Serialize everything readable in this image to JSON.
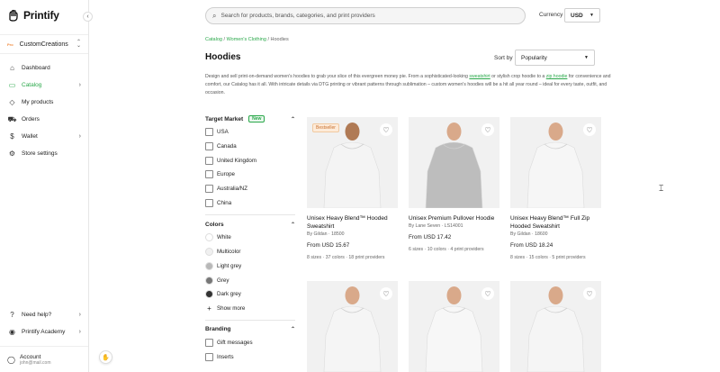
{
  "brand": {
    "name": "Printify"
  },
  "store": {
    "badge": "Pro",
    "name": "CustomCreations"
  },
  "nav": [
    {
      "label": "Dashboard",
      "icon": "home-icon",
      "glyph": "⌂",
      "active": false,
      "chev": ""
    },
    {
      "label": "Catalog",
      "icon": "catalog-icon",
      "glyph": "▭",
      "active": true,
      "chev": "›"
    },
    {
      "label": "My products",
      "icon": "tag-icon",
      "glyph": "◇",
      "active": false,
      "chev": ""
    },
    {
      "label": "Orders",
      "icon": "truck-icon",
      "glyph": "⛟",
      "active": false,
      "chev": ""
    },
    {
      "label": "Wallet",
      "icon": "dollar-icon",
      "glyph": "$",
      "active": false,
      "chev": "›"
    },
    {
      "label": "Store settings",
      "icon": "gear-icon",
      "glyph": "⚙",
      "active": false,
      "chev": ""
    }
  ],
  "nav_bottom": [
    {
      "label": "Need help?",
      "icon": "help-icon",
      "glyph": "?",
      "chev": "›"
    },
    {
      "label": "Printify Academy",
      "icon": "academy-icon",
      "glyph": "◉",
      "chev": "›"
    }
  ],
  "account": {
    "label": "Account",
    "email": "john@mail.com"
  },
  "search": {
    "placeholder": "Search for products, brands, categories, and print providers"
  },
  "currency": {
    "label": "Currency",
    "value": "USD"
  },
  "breadcrumb": {
    "catalog": "Catalog",
    "sep": " / ",
    "womens": "Women's Clothing",
    "current": "Hoodies"
  },
  "page": {
    "title": "Hoodies",
    "sort_label": "Sort by",
    "sort_value": "Popularity",
    "desc_1": "Design and sell print-on-demand women's hoodies to grab your slice of this evergreen money pie. From a sophisticated-looking ",
    "desc_link1": "sweatshirt",
    "desc_2": " or stylish crop hoodie to a ",
    "desc_link2": "zip hoodie",
    "desc_3": " for convenience and comfort, our Catalog has it all. With intricate details via DTG printing or vibrant patterns through sublimation – custom women's hoodies will be a hit all year round – ideal for every taste, outfit, and occasion."
  },
  "filters": {
    "target_market": {
      "title": "Target Market",
      "badge": "New",
      "options": [
        "USA",
        "Canada",
        "United Kingdom",
        "Europe",
        "Australia/NZ",
        "China"
      ]
    },
    "colors": {
      "title": "Colors",
      "options": [
        {
          "name": "White",
          "hex": "#ffffff"
        },
        {
          "name": "Multicolor",
          "hex": "#f0f0f0"
        },
        {
          "name": "Light grey",
          "hex": "#b8b8b8"
        },
        {
          "name": "Grey",
          "hex": "#777777"
        },
        {
          "name": "Dark grey",
          "hex": "#333333"
        }
      ],
      "show_more": "Show more"
    },
    "branding": {
      "title": "Branding",
      "options": [
        "Gift messages",
        "Inserts"
      ]
    }
  },
  "products": [
    {
      "title": "Unisex Heavy Blend™ Hooded Sweatshirt",
      "by": "By Gildan · 18500",
      "price": "From USD 15.67",
      "meta": "8 sizes · 37 colors · 18 print providers",
      "badge": "Bestseller",
      "garment": "#f4f4f4"
    },
    {
      "title": "Unisex Premium Pullover Hoodie",
      "by": "By Lane Seven · LS14001",
      "price": "From USD 17.42",
      "meta": "6 sizes · 10 colors · 4 print providers",
      "badge": "",
      "garment": "#bdbdbd"
    },
    {
      "title": "Unisex Heavy Blend™ Full Zip Hooded Sweatshirt",
      "by": "By Gildan · 18600",
      "price": "From USD 18.24",
      "meta": "8 sizes · 15 colors · 5 print providers",
      "badge": "",
      "garment": "#f6f6f6"
    },
    {
      "title": "",
      "by": "",
      "price": "",
      "meta": "",
      "badge": "",
      "garment": "#f5f5f5"
    },
    {
      "title": "",
      "by": "",
      "price": "",
      "meta": "",
      "badge": "",
      "garment": "#f7f7f7"
    },
    {
      "title": "",
      "by": "",
      "price": "",
      "meta": "",
      "badge": "",
      "garment": "#f5f5f5"
    }
  ],
  "colors": {
    "accent": "#2aa84a"
  }
}
